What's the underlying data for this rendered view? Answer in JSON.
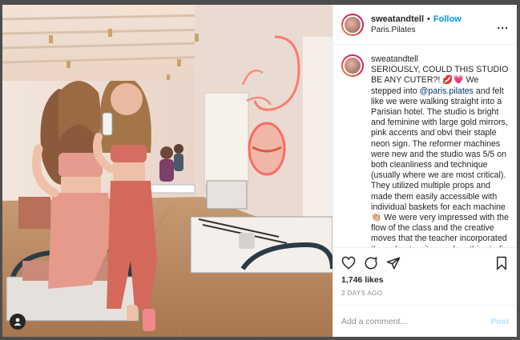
{
  "post": {
    "username": "sweatandtell",
    "follow_label": "Follow",
    "separator": "•",
    "location": "Paris.Pilates",
    "more_label": "...",
    "caption_username": "sweatandtell",
    "caption_part1": "SERIOUSLY, COULD THIS STUDIO BE ANY CUTER?! 💋💗 We stepped into ",
    "caption_mention": "@paris.pilates",
    "caption_part2": " and felt like we were walking straight into a Parisian hotel. The studio is bright and feminine with large gold mirrors, pink accents and obvi their staple neon sign. The reformer machines were new and the studio was 5/5 on both cleanliness and technique (usually where we are most critical). They utilized multiple props and made them easily accessible with individual baskets for each machine 👏🏼 We were very impressed with the flow of the class and the creative moves that the teacher incorporated throughout — it was clear this studio works hard to design challenging classes, with fresh",
    "likes": "1,746 likes",
    "time_ago": "2 DAYS AGO",
    "comment_placeholder": "Add a comment...",
    "post_label": "Post"
  },
  "icons": [
    "heart-icon",
    "comment-icon",
    "share-icon",
    "bookmark-icon",
    "user-tag-icon",
    "more-icon"
  ],
  "colors": {
    "follow": "#0095f6",
    "mention": "#00376b",
    "post_disabled": "#b2dffc",
    "muted": "#8e8e8e"
  }
}
